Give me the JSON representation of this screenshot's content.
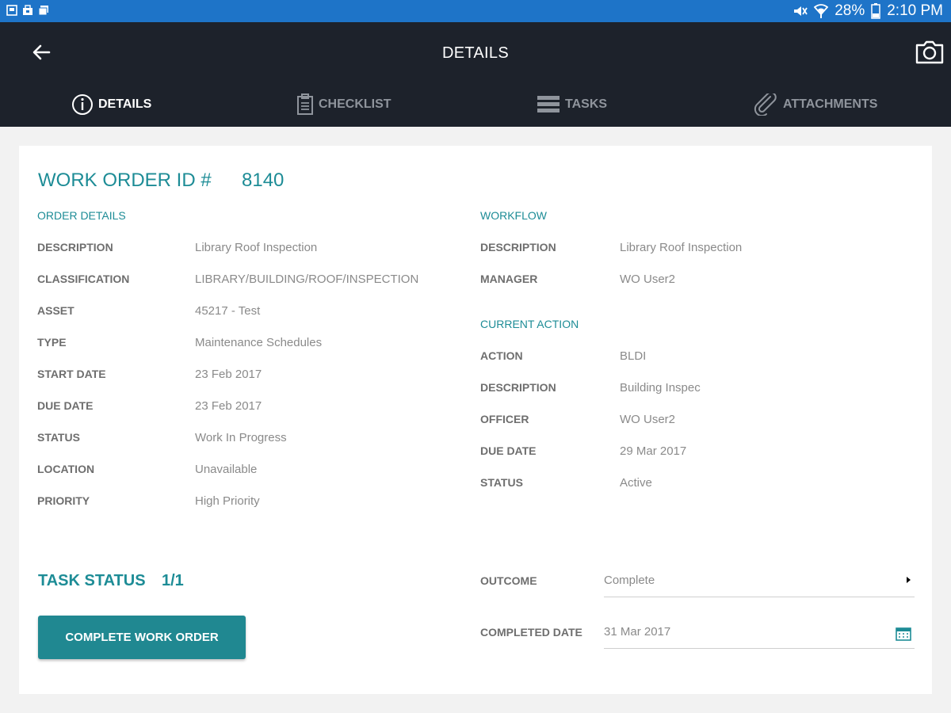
{
  "status_bar": {
    "battery": "28%",
    "time": "2:10 PM"
  },
  "app_bar": {
    "title": "DETAILS"
  },
  "tabs": [
    {
      "label": "DETAILS",
      "icon": "info-icon",
      "active": true
    },
    {
      "label": "CHECKLIST",
      "icon": "clipboard-icon",
      "active": false
    },
    {
      "label": "TASKS",
      "icon": "list-icon",
      "active": false
    },
    {
      "label": "ATTACHMENTS",
      "icon": "paperclip-icon",
      "active": false
    }
  ],
  "work_order": {
    "title_label": "WORK ORDER ID #",
    "id": "8140"
  },
  "order_details": {
    "heading": "ORDER DETAILS",
    "rows": [
      {
        "label": "DESCRIPTION",
        "value": "Library Roof Inspection"
      },
      {
        "label": "CLASSIFICATION",
        "value": "LIBRARY/BUILDING/ROOF/INSPECTION"
      },
      {
        "label": "ASSET",
        "value": "45217 - Test"
      },
      {
        "label": "TYPE",
        "value": "Maintenance Schedules"
      },
      {
        "label": "START DATE",
        "value": "23 Feb 2017"
      },
      {
        "label": "DUE DATE",
        "value": "23 Feb 2017"
      },
      {
        "label": "STATUS",
        "value": "Work In Progress"
      },
      {
        "label": "LOCATION",
        "value": "Unavailable"
      },
      {
        "label": "PRIORITY",
        "value": "High Priority"
      }
    ]
  },
  "workflow": {
    "heading": "WORKFLOW",
    "rows": [
      {
        "label": "DESCRIPTION",
        "value": "Library Roof Inspection"
      },
      {
        "label": "MANAGER",
        "value": "WO User2"
      }
    ]
  },
  "current_action": {
    "heading": "CURRENT ACTION",
    "rows": [
      {
        "label": "ACTION",
        "value": "BLDI"
      },
      {
        "label": "DESCRIPTION",
        "value": "Building Inspec"
      },
      {
        "label": "OFFICER",
        "value": "WO User2"
      },
      {
        "label": "DUE DATE",
        "value": "29 Mar 2017"
      },
      {
        "label": "STATUS",
        "value": "Active"
      }
    ]
  },
  "task_status": {
    "label": "TASK STATUS",
    "count": "1/1"
  },
  "complete_button": "COMPLETE WORK ORDER",
  "outcome": {
    "label": "OUTCOME",
    "value": "Complete"
  },
  "completed_date": {
    "label": "COMPLETED DATE",
    "value": "31 Mar 2017"
  },
  "colors": {
    "status_bar": "#1e74c8",
    "app_bar": "#1d222b",
    "accent": "#1d8c96",
    "button": "#208891"
  }
}
